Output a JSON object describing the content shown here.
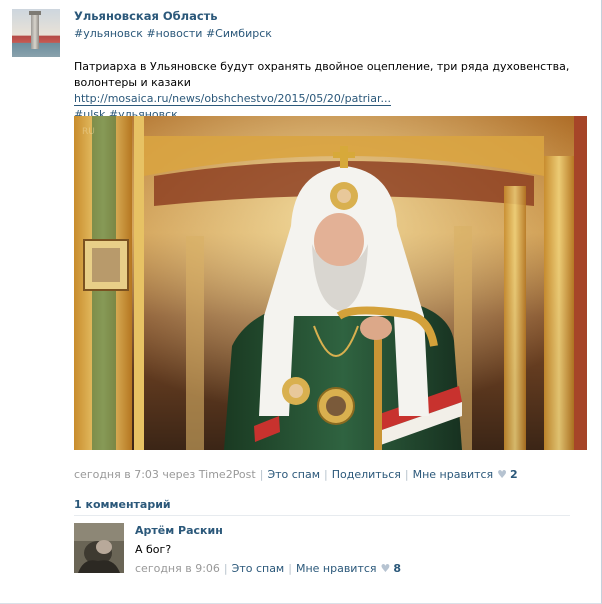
{
  "post": {
    "group_name": "Ульяновская Область",
    "tags": [
      "#ульяновск",
      "#новости",
      "#Симбирск"
    ],
    "text": "Патриарха в Ульяновске будут охранять двойное оцепление, три ряда духовенства, волонтеры и казаки",
    "link": "http://mosaica.ru/news/obshchestvo/2015/05/20/patriar...",
    "extra_tags": [
      "#ulsk",
      "#ульяновск"
    ],
    "time_label": "сегодня в 7:03 через Time2Post",
    "spam_label": "Это спам",
    "share_label": "Поделиться",
    "like_label": "Мне нравится",
    "like_count": "2"
  },
  "comments": {
    "title": "1 комментарий",
    "items": [
      {
        "author": "Артём Раскин",
        "text": "А бог?",
        "time_label": "сегодня в 9:06",
        "spam_label": "Это спам",
        "like_label": "Мне нравится",
        "like_count": "8"
      }
    ]
  },
  "icons": {
    "like": "heart-icon"
  },
  "colors": {
    "link": "#2b587a",
    "muted": "#999999"
  }
}
